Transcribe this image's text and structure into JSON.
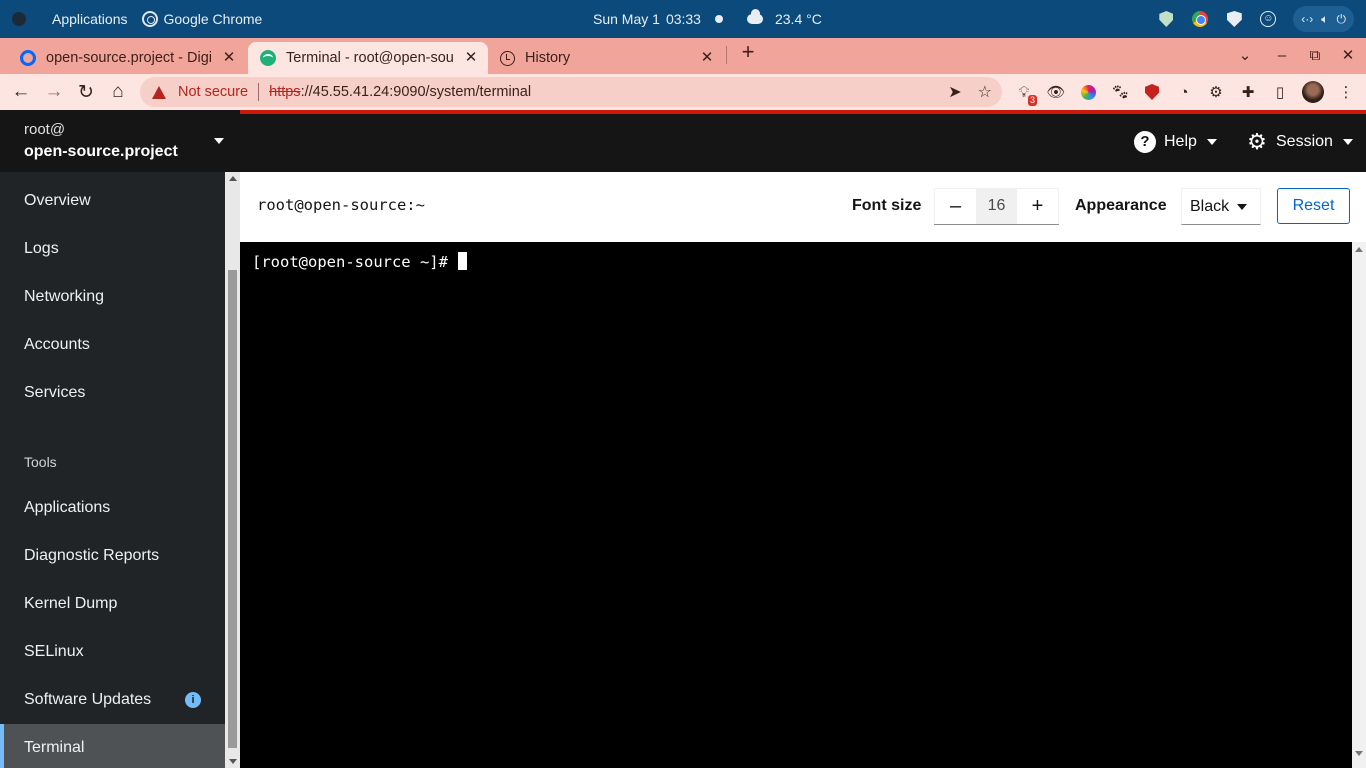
{
  "os_panel": {
    "applications_label": "Applications",
    "active_app": "Google Chrome",
    "date": "Sun May 1",
    "time": "03:33",
    "weather": "23.4 °C"
  },
  "browser": {
    "tabs": [
      {
        "label": "open-source.project - Digi",
        "icon": "digitalocean-icon"
      },
      {
        "label": "Terminal - root@open-sou",
        "icon": "cockpit-icon",
        "active": true
      },
      {
        "label": "History",
        "icon": "history-icon"
      }
    ],
    "omnibox": {
      "security_label": "Not secure",
      "url_scheme": "https",
      "url_rest": "://45.55.41.24:9090/system/terminal"
    },
    "extension_badge": "3"
  },
  "sidebar": {
    "host_user": "root@",
    "host_name": "open-source.project",
    "items": [
      {
        "label": "Overview"
      },
      {
        "label": "Logs"
      },
      {
        "label": "Networking"
      },
      {
        "label": "Accounts"
      },
      {
        "label": "Services"
      }
    ],
    "tools_heading": "Tools",
    "tools": [
      {
        "label": "Applications"
      },
      {
        "label": "Diagnostic Reports"
      },
      {
        "label": "Kernel Dump"
      },
      {
        "label": "SELinux"
      },
      {
        "label": "Software Updates"
      },
      {
        "label": "Terminal",
        "active": true
      }
    ],
    "info_badge": "i"
  },
  "masthead": {
    "help_label": "Help",
    "session_label": "Session"
  },
  "terminal": {
    "title": "root@open-source:~",
    "font_size_label": "Font size",
    "font_size_minus": "–",
    "font_size_value": "16",
    "font_size_plus": "+",
    "appearance_label": "Appearance",
    "appearance_value": "Black",
    "reset_label": "Reset",
    "prompt": "[root@open-source ~]# "
  },
  "colors": {
    "os_panel": "#0b4a7a",
    "tabstrip": "#f1a59a",
    "toolbar": "#fde6e2",
    "sidebar": "#212427",
    "masthead": "#151515",
    "accent": "#0066cc",
    "active_nav_marker": "#73bcf7"
  }
}
